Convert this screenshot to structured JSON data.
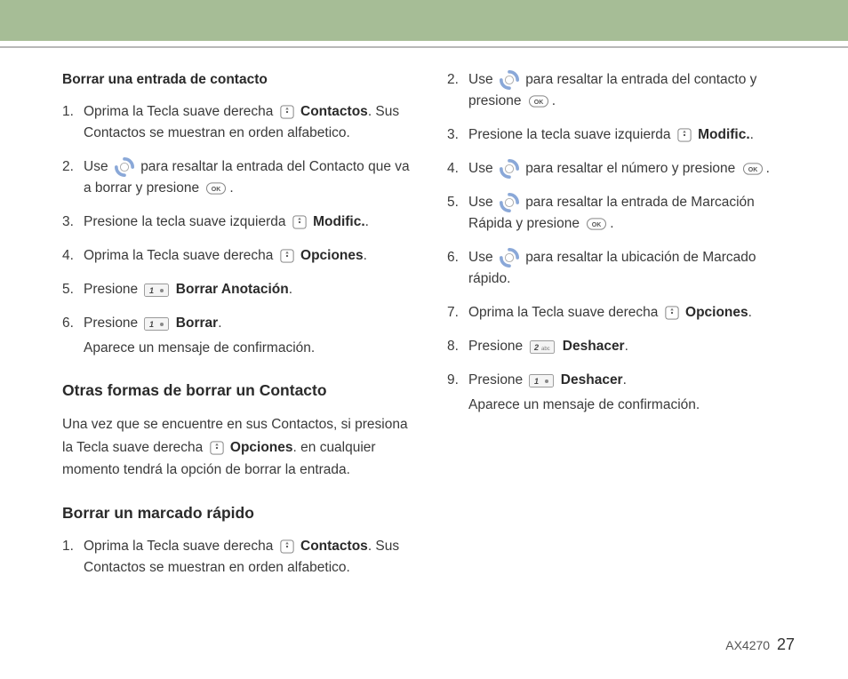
{
  "footer": {
    "model": "AX4270",
    "page": "27"
  },
  "left": {
    "heading1": "Borrar una entrada de contacto",
    "steps1": {
      "s1a": "Oprima la Tecla suave derecha ",
      "s1b": "Contactos",
      "s1c": ". Sus Contactos se muestran en orden alfabetico.",
      "s2a": "Use ",
      "s2b": " para resaltar la entrada del Contacto que va a borrar y presione ",
      "s2c": ".",
      "s3a": "Presione la tecla suave izquierda ",
      "s3b": "Modific.",
      "s3c": ".",
      "s4a": "Oprima la Tecla suave derecha ",
      "s4b": "Opciones",
      "s4c": ".",
      "s5a": "Presione ",
      "s5b": "Borrar Anotación",
      "s5c": ".",
      "s6a": "Presione ",
      "s6b": "Borrar",
      "s6c": ".",
      "s6d": "Aparece un mensaje de confirmación."
    },
    "heading2": "Otras formas de borrar un Contacto",
    "para2a": "Una vez que se encuentre en sus Contactos, si presiona la Tecla suave derecha ",
    "para2b": "Opciones",
    "para2c": ". en cualquier momento tendrá la opción de borrar la entrada.",
    "heading3": "Borrar un marcado rápido",
    "steps3": {
      "s1a": "Oprima la Tecla suave derecha ",
      "s1b": "Contactos",
      "s1c": ". Sus Contactos se muestran en orden alfabetico."
    }
  },
  "right": {
    "s2a": "Use ",
    "s2b": " para resaltar la entrada del contacto y presione ",
    "s2c": ".",
    "s3a": "Presione la tecla suave izquierda ",
    "s3b": "Modific.",
    "s3c": ".",
    "s4a": "Use ",
    "s4b": " para resaltar el número y presione ",
    "s4c": ".",
    "s5a": "Use ",
    "s5b": " para resaltar la entrada de Marcación Rápida y presione ",
    "s5c": ".",
    "s6a": "Use ",
    "s6b": " para resaltar la ubicación de Marcado rápido.",
    "s7a": "Oprima la Tecla suave derecha ",
    "s7b": "Opciones",
    "s7c": ".",
    "s8a": "Presione ",
    "s8b": "Deshacer",
    "s8c": ".",
    "s9a": "Presione ",
    "s9b": "Deshacer",
    "s9c": ".",
    "s9d": "Aparece un mensaje de confirmación."
  },
  "keys": {
    "k1": "1",
    "k2": "2",
    "abc": "abc"
  }
}
